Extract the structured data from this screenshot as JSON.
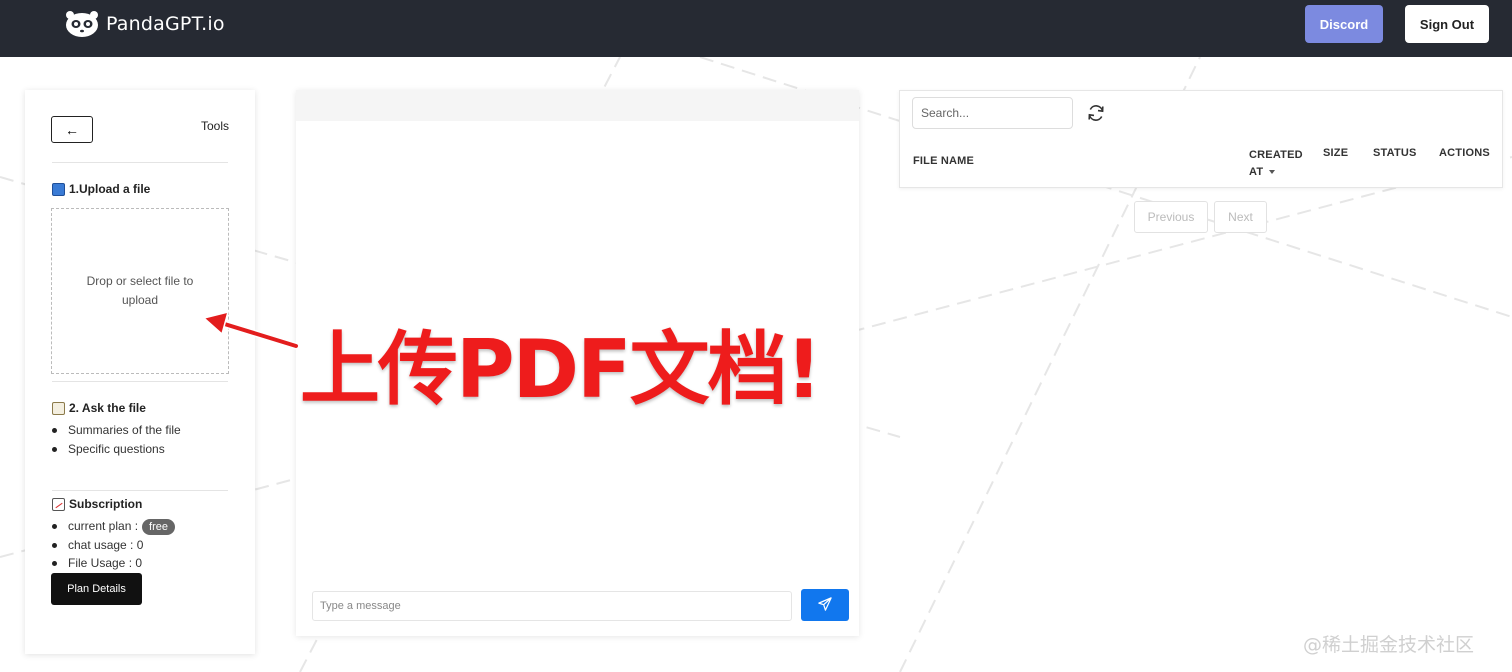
{
  "header": {
    "brand": "PandaGPT.io",
    "discord_label": "Discord",
    "signout_label": "Sign Out"
  },
  "tools": {
    "back_glyph": "←",
    "title": "Tools",
    "upload": {
      "heading": "1.Upload a file",
      "dropzone_text": "Drop or select file to upload"
    },
    "ask": {
      "heading": "2. Ask the file",
      "items": [
        "Summaries of the file",
        "Specific questions"
      ]
    },
    "subscription": {
      "heading": "Subscription",
      "plan_label": "current plan :",
      "plan_badge": "free",
      "chat_usage": "chat usage : 0",
      "file_usage": "File Usage : 0",
      "plan_button": "Plan Details"
    }
  },
  "chat": {
    "input_placeholder": "Type a message"
  },
  "files": {
    "search_placeholder": "Search...",
    "columns": {
      "file_name": "FILE NAME",
      "created_line1": "CREATED",
      "created_line2": "AT",
      "size": "SIZE",
      "status": "STATUS",
      "actions": "ACTIONS"
    },
    "pagination": {
      "previous": "Previous",
      "next": "Next"
    }
  },
  "annotation": {
    "text": "上传PDF文档!"
  },
  "watermark": "@稀土掘金技术社区",
  "colors": {
    "header_bg": "#262a33",
    "discord": "#7c8ae0",
    "send": "#1177ee",
    "annotation": "#ee1c1c"
  },
  "icons": [
    "panda-logo-icon",
    "arrow-left-icon",
    "book-icon",
    "memo-icon",
    "chart-icon",
    "send-icon",
    "refresh-icon",
    "sort-caret-icon",
    "red-arrow-icon"
  ]
}
